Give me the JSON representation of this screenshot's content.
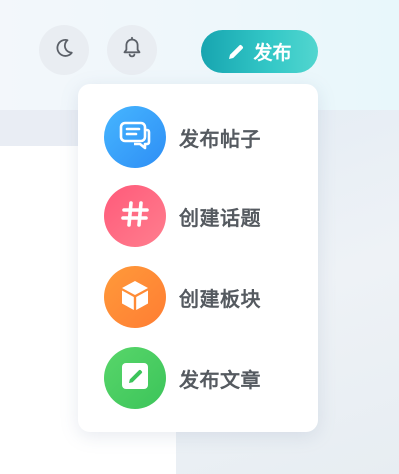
{
  "theme": {
    "accent": "#1fb0b8",
    "menu_colors": [
      "#2e8ef5",
      "#ff5a7a",
      "#ff8a36",
      "#48cc5f"
    ]
  },
  "header": {
    "dark_mode_icon": "moon-icon",
    "notification_icon": "bell-icon",
    "publish": {
      "icon": "pencil-icon",
      "label": "发布"
    }
  },
  "publish_menu": {
    "items": [
      {
        "icon": "chat-bubble-icon",
        "label": "发布帖子"
      },
      {
        "icon": "hashtag-icon",
        "label": "创建话题"
      },
      {
        "icon": "cube-icon",
        "label": "创建板块"
      },
      {
        "icon": "edit-note-icon",
        "label": "发布文章"
      }
    ]
  }
}
